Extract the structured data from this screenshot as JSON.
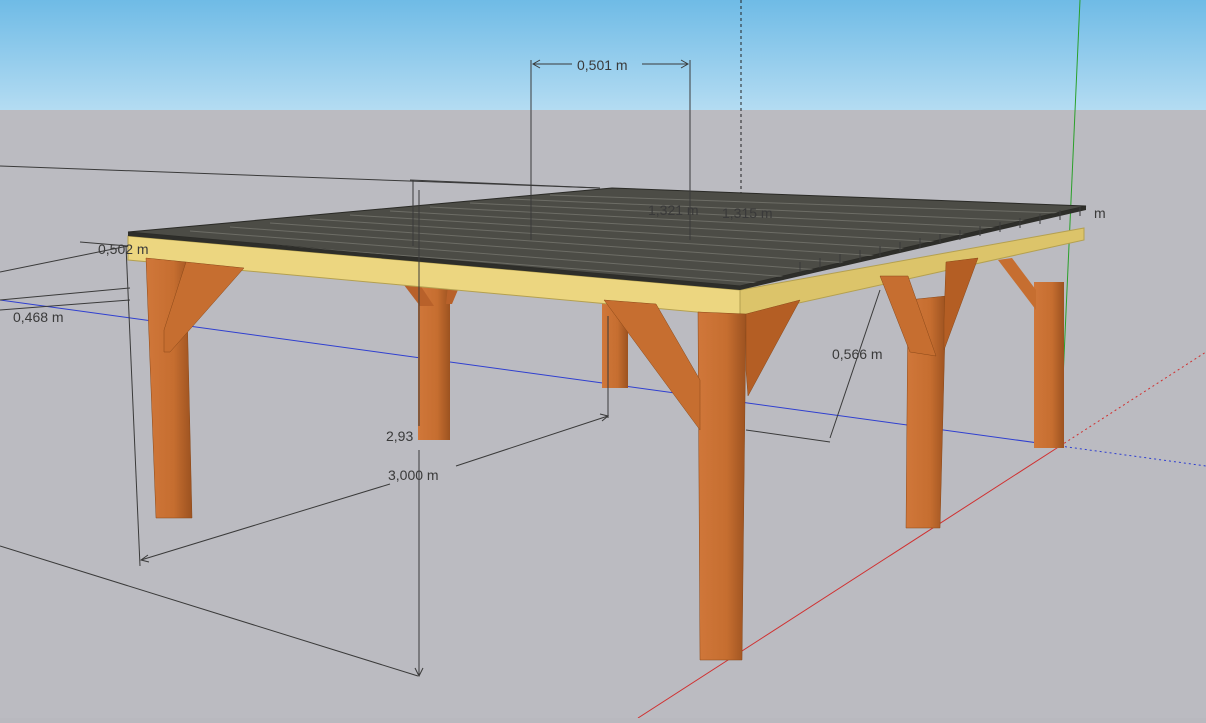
{
  "scene": {
    "sky_color": "#8ec8ea",
    "ground_color": "#bbbbc1",
    "wood_color": "#c46a2c",
    "beam_color": "#e8d27a",
    "deck_color": "#4a4a44"
  },
  "dimensions": {
    "top_span": "0,501 m",
    "left_overhang": "0,502 m",
    "left_lower": "0,468 m",
    "right_bracket": "0,566 m",
    "height_partial": "2,93",
    "length": "3,000 m",
    "roof_a": "1,321 m",
    "roof_b": "1,315 m",
    "rafter_repeat": "m"
  }
}
